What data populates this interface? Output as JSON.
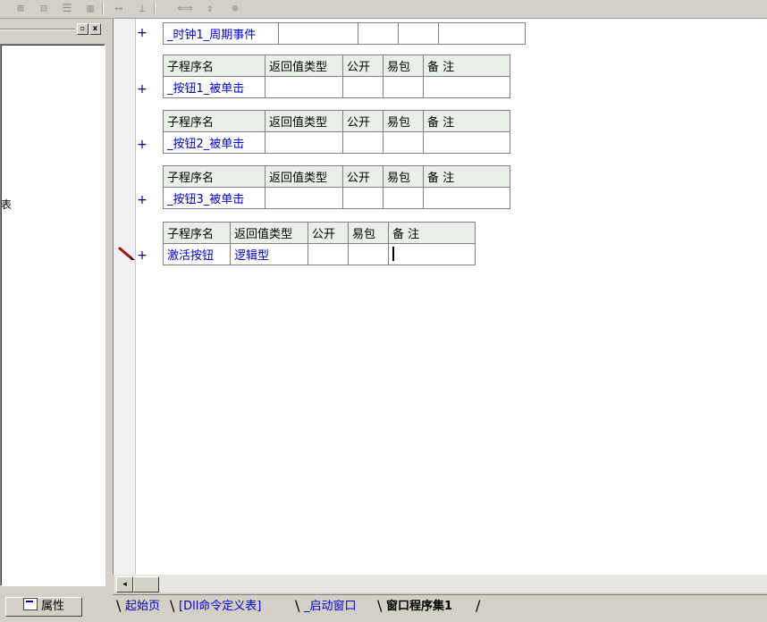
{
  "toolbar": {
    "buttons": [
      "⊞",
      "⊟",
      "☰",
      "▥",
      "⟷",
      "⊥",
      "⟺",
      "⇕",
      "⊕"
    ]
  },
  "left_panel": {
    "restore_label": "▫",
    "close_label": "x",
    "tree_glyph": "表"
  },
  "properties_tab": {
    "label": "属性"
  },
  "editor": {
    "timer_row": {
      "name": "_时钟1_周期事件"
    },
    "subroutines": [
      {
        "headers": [
          "子程序名",
          "返回值类型",
          "公开",
          "易包",
          "备 注"
        ],
        "name": "_按钮1_被单击",
        "return_type": "",
        "public": "",
        "easy_pack": "",
        "note": ""
      },
      {
        "headers": [
          "子程序名",
          "返回值类型",
          "公开",
          "易包",
          "备 注"
        ],
        "name": "_按钮2_被单击",
        "return_type": "",
        "public": "",
        "easy_pack": "",
        "note": ""
      },
      {
        "headers": [
          "子程序名",
          "返回值类型",
          "公开",
          "易包",
          "备 注"
        ],
        "name": "_按钮3_被单击",
        "return_type": "",
        "public": "",
        "easy_pack": "",
        "note": ""
      },
      {
        "headers": [
          "子程序名",
          "返回值类型",
          "公开",
          "易包",
          "备 注"
        ],
        "name": "激活按钮",
        "return_type": "逻辑型",
        "public": "",
        "easy_pack": "",
        "note": ""
      }
    ],
    "plus_symbol": "+"
  },
  "scrollbar": {
    "left_arrow": "◂"
  },
  "doc_tabs": [
    {
      "label": "起始页",
      "active": false
    },
    {
      "label": "[Dll命令定义表]",
      "active": false
    },
    {
      "label": "_启动窗口",
      "active": false
    },
    {
      "label": "窗口程序集1",
      "active": true
    }
  ],
  "colors": {
    "code_text": "#0000c8",
    "header_bg": "#e8f0e8",
    "gutter_bg": "#f0f0f0",
    "pencil": "#a01010"
  }
}
